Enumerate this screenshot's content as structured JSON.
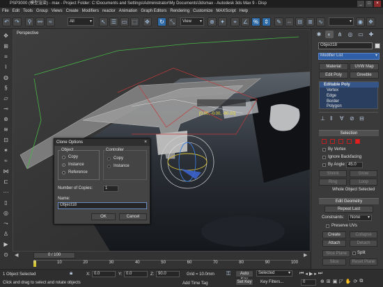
{
  "title": "PSP3000 (模型渲染) - max - Project Folder: C:\\Documents and Settings\\Administrator\\My Documents\\3dsmax - Autodesk 3ds Max 9 - Disp",
  "menu": [
    "File",
    "Edit",
    "Tools",
    "Group",
    "Views",
    "Create",
    "Modifiers",
    "reactor",
    "Animation",
    "Graph Editors",
    "Rendering",
    "Customize",
    "MAXScript",
    "Help"
  ],
  "toolbar": {
    "selection_filter": "All",
    "ref_coord": "View"
  },
  "viewport": {
    "label": "Perspective",
    "coord_readout": "[0.00, -0.00, -90.00]"
  },
  "command_panel": {
    "object_name": "Object18",
    "modifier_list": "Modifier List",
    "buttons": [
      "Material",
      "UVW Map",
      "Edit Poly",
      "Greeble"
    ],
    "stack": {
      "root": "Editable Poly",
      "items": [
        "Vertex",
        "Edge",
        "Border",
        "Polygon"
      ]
    },
    "selection": {
      "title": "Selection",
      "options": [
        "By Vertex",
        "Ignore Backfacing",
        "By Angle:",
        "Shrink",
        "Grow",
        "Ring",
        "Loop"
      ],
      "angle_value": "45.0",
      "status": "Whole Object Selected"
    },
    "edit_geometry": {
      "title": "Edit Geometry",
      "repeat_last": "Repeat Last",
      "constraints_label": "Constraints:",
      "constraints_value": "None",
      "preserve_uvs": "Preserve UVs",
      "create": "Create",
      "collapse": "Collapse",
      "attach": "Attach",
      "detach": "Detach",
      "slice_plane": "Slice Plane",
      "split": "Split",
      "slice": "Slice",
      "reset_plane": "Reset Plane"
    }
  },
  "dialog": {
    "title": "Clone Options",
    "object_group": "Object",
    "controller_group": "Controller",
    "object_options": [
      "Copy",
      "Instance",
      "Reference"
    ],
    "object_selected": "Instance",
    "controller_options": [
      "Copy",
      "Instance"
    ],
    "copies_label": "Number of Copies:",
    "copies_value": "1",
    "name_label": "Name:",
    "name_value": "Object18",
    "ok": "OK",
    "cancel": "Cancel"
  },
  "timeline": {
    "frame": "0 / 100",
    "ticks": [
      "0",
      "10",
      "20",
      "30",
      "40",
      "50",
      "60",
      "70",
      "80",
      "90",
      "100"
    ]
  },
  "status": {
    "selected": "1 Object Selected",
    "prompt": "Click and drag to select and rotate objects",
    "x": "0.0",
    "y": "0.0",
    "z": "90.0",
    "grid": "Grid = 10.0mm",
    "auto_key": "Auto Key",
    "set_key": "Set Key",
    "key_mode": "Selected",
    "key_filters": "Key Filters...",
    "add_time_tag": "Add Time Tag",
    "frame_counter": "0"
  }
}
